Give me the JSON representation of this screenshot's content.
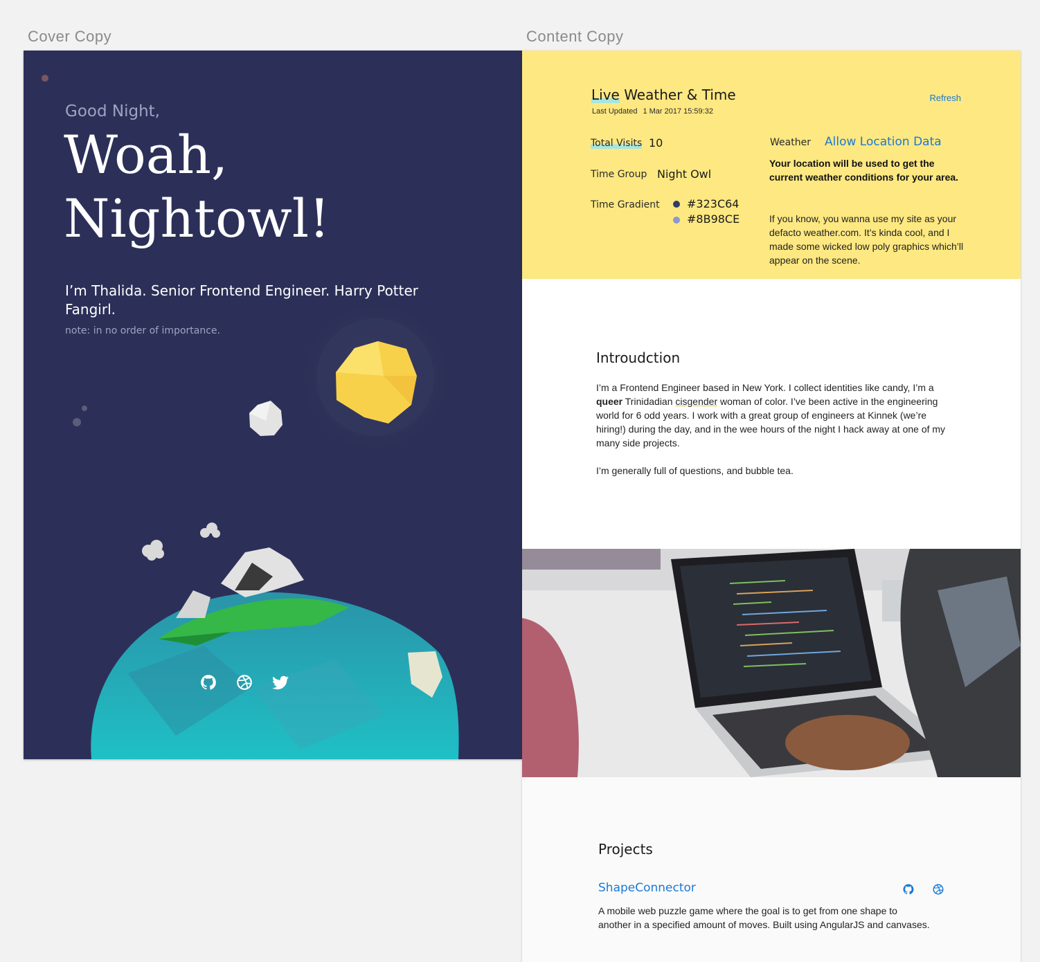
{
  "artboards": {
    "cover_label": "Cover Copy",
    "content_label": "Content Copy"
  },
  "cover": {
    "greeting": "Good Night,",
    "headline": "Woah, Nightowl!",
    "tagline": "I’m Thalida. Senior Frontend Engineer. Harry Potter Fangirl.",
    "note": "note: in no order of importance.",
    "background_color": "#2C3058",
    "socials": [
      "github-icon",
      "dribbble-icon",
      "twitter-icon"
    ]
  },
  "weather_panel": {
    "title_highlight": "Live",
    "title_rest": " Weather & Time",
    "last_updated_label": "Last Updated",
    "last_updated_value": "1 Mar 2017 15:59:32",
    "refresh_label": "Refresh",
    "total_visits_label": "Total Visits",
    "total_visits_value": "10",
    "time_group_label": "Time Group",
    "time_group_value": "Night Owl",
    "time_gradient_label": "Time Gradient",
    "gradient_color_1": "#323C64",
    "gradient_color_2": "#8B98CE",
    "weather_label": "Weather",
    "allow_location_label": "Allow Location Data",
    "location_note": "Your location will be used to get the current weather conditions for your area.",
    "location_description": "If you know, you wanna use my site as your defacto weather.com. It’s kinda cool, and I made some wicked low poly graphics which’ll appear on the scene.",
    "background_color": "#FDE881"
  },
  "introduction": {
    "title": "Introudction",
    "p1_a": "I’m a Frontend Engineer based in New York. I collect identities like candy, I’m a ",
    "p1_b": "queer",
    "p1_c": " Trinidadian ",
    "p1_d": "cisgender",
    "p1_e": " woman of color. I’ve been active in the engineering world for 6 odd years. I work with a great group of engineers at Kinnek (we’re hiring!) during the day, and in the wee hours of the night I hack away at one of my many side projects.",
    "p2": "I’m generally full of questions, and bubble tea."
  },
  "projects": {
    "title": "Projects",
    "items": [
      {
        "name": "ShapeConnector",
        "description": "A mobile web puzzle game where the goal is to get from one shape to another in a specified amount of moves. Built using AngularJS and canvases.",
        "icons": [
          "github-icon",
          "dribbble-icon"
        ]
      }
    ]
  }
}
